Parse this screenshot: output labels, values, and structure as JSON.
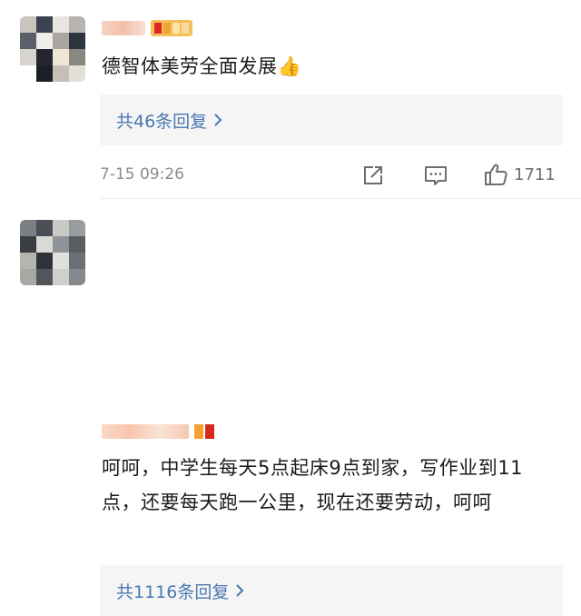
{
  "comments": [
    {
      "text": "德智体美劳全面发展👍",
      "reply_label": "共46条回复",
      "time": "7-15 09:26",
      "like_count": "1711"
    },
    {
      "text": "呵呵，中学生每天5点起床9点到家，写作业到11点，还要每天跑一公里，现在还要劳动，呵呵",
      "reply_label": "共1116条回复"
    }
  ],
  "icons": {
    "share": "share-icon",
    "comment": "comment-icon",
    "like": "thumbs-up-icon",
    "chevron": "chevron-right-icon"
  },
  "colors": {
    "link": "#4a78b0",
    "meta": "#8c8c8c",
    "reply_bg": "#f5f5f5"
  }
}
